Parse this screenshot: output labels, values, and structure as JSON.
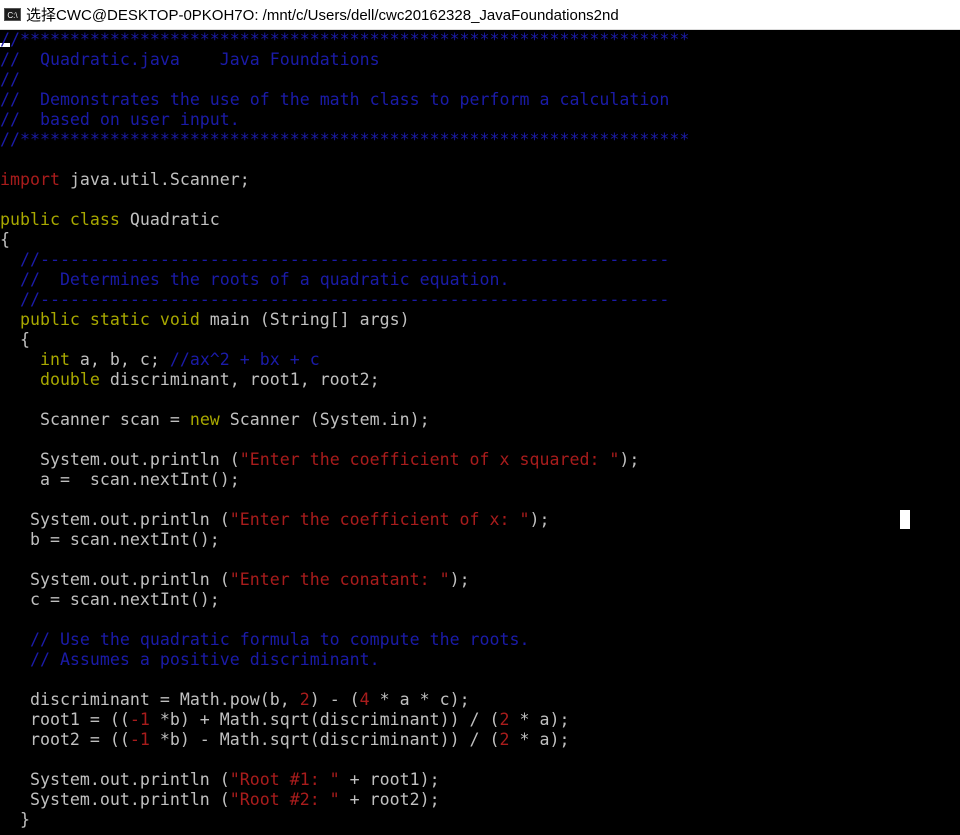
{
  "window": {
    "title": "选择CWC@DESKTOP-0PKOH7O: /mnt/c/Users/dell/cwc20162328_JavaFoundations2nd",
    "icon": "console-icon",
    "icon_label": "C:\\"
  },
  "code": {
    "l1": "//*******************************************************************",
    "l2": "//  Quadratic.java    Java Foundations",
    "l3": "//",
    "l4": "//  Demonstrates the use of the math class to perform a calculation",
    "l5": "//  based on user input.",
    "l6": "//*******************************************************************",
    "import_kw": "import",
    "import_rest": " java.util.Scanner;",
    "public_class_kw": "public class",
    "class_name": " Quadratic",
    "open_brace": "{",
    "cm1": "  //---------------------------------------------------------------",
    "cm2": "  //  Determines the roots of a quadratic equation.",
    "cm3": "  //---------------------------------------------------------------",
    "main_kw": "  public static void",
    "main_rest": " main (String[] args)",
    "main_brace": "  {",
    "int_kw": "    int",
    "int_rest": " a, b, c; ",
    "int_comment": "//ax^2 + bx + c",
    "double_kw": "    double",
    "double_rest": " discriminant, root1, root2;",
    "scan_a": "    Scanner scan = ",
    "scan_new": "new",
    "scan_b": " Scanner (System.in);",
    "p1_a": "    System.out.println (",
    "p1_s": "\"Enter the coefficient of x squared: \"",
    "p1_b": ");",
    "a_line": "    a =  scan.nextInt();",
    "p2_a": "   System.out.println (",
    "p2_s": "\"Enter the coefficient of x: \"",
    "p2_b": ");",
    "b_line": "   b = scan.nextInt();",
    "p3_a": "   System.out.println (",
    "p3_s": "\"Enter the conatant: \"",
    "p3_b": ");",
    "c_line": "   c = scan.nextInt();",
    "cm4": "   // Use the quadratic formula to compute the roots.",
    "cm5": "   // Assumes a positive discriminant.",
    "d_a": "   discriminant = Math.pow(b, ",
    "d_n1": "2",
    "d_b": ") - (",
    "d_n2": "4",
    "d_c": " * a * c);",
    "r1_a": "   root1 = ((",
    "r1_n1": "-1",
    "r1_b": " *b) + Math.sqrt(discriminant)) / (",
    "r1_n2": "2",
    "r1_c": " * a);",
    "r2_a": "   root2 = ((",
    "r2_n1": "-1",
    "r2_b": " *b) - Math.sqrt(discriminant)) / (",
    "r2_n2": "2",
    "r2_c": " * a);",
    "o1_a": "   System.out.println (",
    "o1_s": "\"Root #1: \"",
    "o1_b": " + root1);",
    "o2_a": "   System.out.println (",
    "o2_s": "\"Root #2: \"",
    "o2_b": " + root2);",
    "close_brace": "  }"
  },
  "colors": {
    "comment": "#1b1ba8",
    "keyword": "#a8a800",
    "string": "#a81c1c",
    "text": "#c0c0c0",
    "background": "#000000"
  }
}
